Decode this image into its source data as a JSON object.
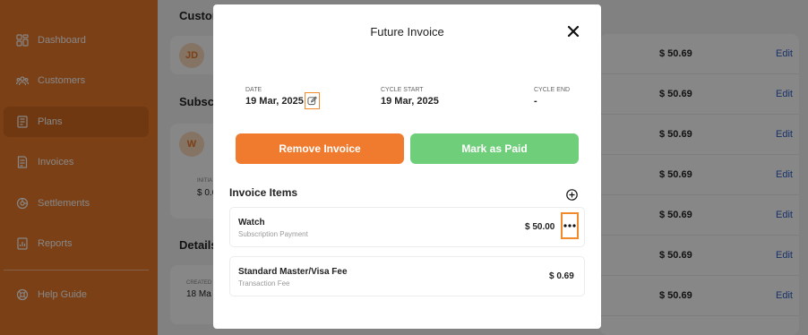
{
  "sidebar": {
    "items": [
      {
        "label": "Dashboard",
        "icon": "dashboard-icon"
      },
      {
        "label": "Customers",
        "icon": "customers-icon"
      },
      {
        "label": "Plans",
        "icon": "plans-icon"
      },
      {
        "label": "Invoices",
        "icon": "invoices-icon"
      },
      {
        "label": "Settlements",
        "icon": "settlements-icon"
      },
      {
        "label": "Reports",
        "icon": "reports-icon"
      }
    ],
    "help": {
      "label": "Help Guide",
      "icon": "help-icon"
    }
  },
  "background": {
    "section_customer": "Custom",
    "section_subscription": "Subscri",
    "section_details": "Details",
    "customer_avatar": "JD",
    "subscription_avatar": "W",
    "initial_label": "INITIA",
    "initial_value": "$ 0.6",
    "created_label": "CREATED",
    "created_value": "18 Ma",
    "rows": [
      {
        "amount": "$ 50.69",
        "edit": "Edit"
      },
      {
        "amount": "$ 50.69",
        "edit": "Edit"
      },
      {
        "amount": "$ 50.69",
        "edit": "Edit"
      },
      {
        "amount": "$ 50.69",
        "edit": "Edit"
      },
      {
        "amount": "$ 50.69",
        "edit": "Edit"
      },
      {
        "amount": "$ 50.69",
        "edit": "Edit"
      },
      {
        "amount": "$ 50.69",
        "edit": "Edit"
      }
    ]
  },
  "modal": {
    "title": "Future Invoice",
    "date_label": "DATE",
    "date_value": "19 Mar, 2025",
    "cycle_start_label": "CYCLE START",
    "cycle_start_value": "19 Mar, 2025",
    "cycle_end_label": "CYCLE END",
    "cycle_end_value": "-",
    "remove_button": "Remove Invoice",
    "paid_button": "Mark as Paid",
    "items_title": "Invoice Items",
    "items": [
      {
        "name": "Watch",
        "sub": "Subscription Payment",
        "price": "$ 50.00"
      },
      {
        "name": "Standard Master/Visa Fee",
        "sub": "Transaction Fee",
        "price": "$ 0.69"
      }
    ]
  },
  "colors": {
    "brand": "#e87a2a",
    "remove": "#f07a2d",
    "paid": "#6fce7a",
    "link": "#2b5fc7"
  }
}
